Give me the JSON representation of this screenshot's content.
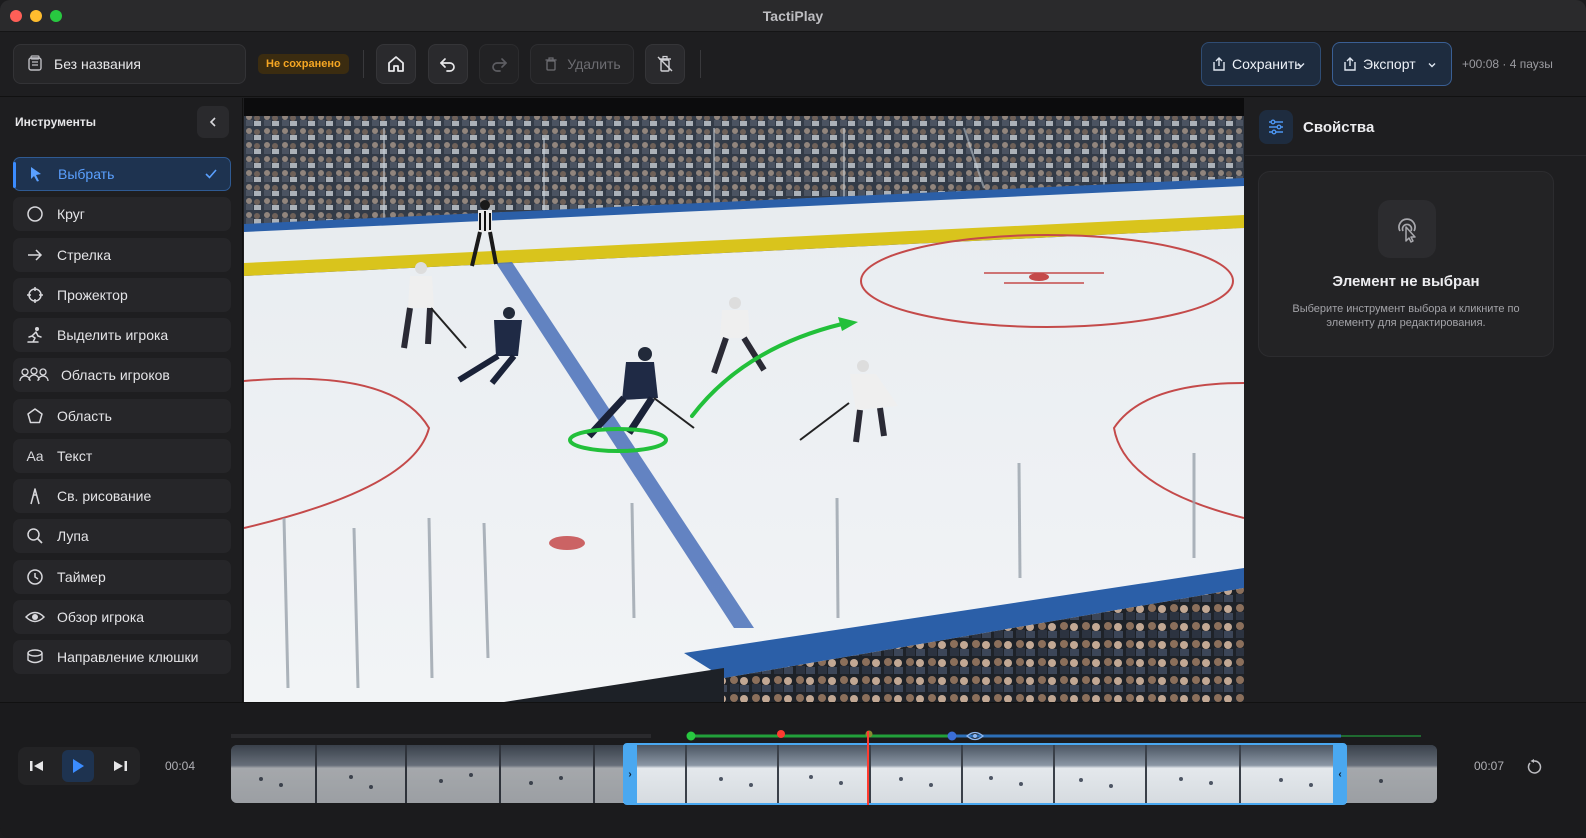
{
  "window": {
    "title": "TactiPlay"
  },
  "toolbar": {
    "file_name": "Без названия",
    "unsaved_badge": "Не сохранено",
    "delete_label": "Удалить",
    "save_label": "Сохранить",
    "export_label": "Экспорт",
    "time_info": "+00:08 · 4 паузы"
  },
  "sidebar": {
    "title": "Инструменты",
    "items": [
      {
        "label": "Выбрать",
        "icon": "cursor-icon",
        "active": true
      },
      {
        "label": "Круг",
        "icon": "circle-icon"
      },
      {
        "label": "Стрелка",
        "icon": "arrow-right-icon"
      },
      {
        "label": "Прожектор",
        "icon": "crosshair-icon"
      },
      {
        "label": "Выделить игрока",
        "icon": "skater-icon"
      },
      {
        "label": "Область игроков",
        "icon": "players-group-icon"
      },
      {
        "label": "Область",
        "icon": "pentagon-icon"
      },
      {
        "label": "Текст",
        "icon": "text-icon",
        "glyph": "Aa"
      },
      {
        "label": "Св. рисование",
        "icon": "pen-icon"
      },
      {
        "label": "Лупа",
        "icon": "magnifier-icon"
      },
      {
        "label": "Таймер",
        "icon": "timer-icon"
      },
      {
        "label": "Обзор игрока",
        "icon": "eye-icon"
      },
      {
        "label": "Направление клюшки",
        "icon": "stick-direction-icon"
      }
    ]
  },
  "properties": {
    "title": "Свойства",
    "empty_title": "Элемент не выбран",
    "empty_text": "Выберите инструмент выбора и кликните по элементу для редактирования."
  },
  "timeline": {
    "current_time": "00:04",
    "end_time": "00:07"
  },
  "colors": {
    "accent": "#3b8cff",
    "unsaved": "#f5a623",
    "annotation_green": "#22c03a",
    "playhead": "#ff3b30",
    "selection": "#4aa8f0"
  }
}
